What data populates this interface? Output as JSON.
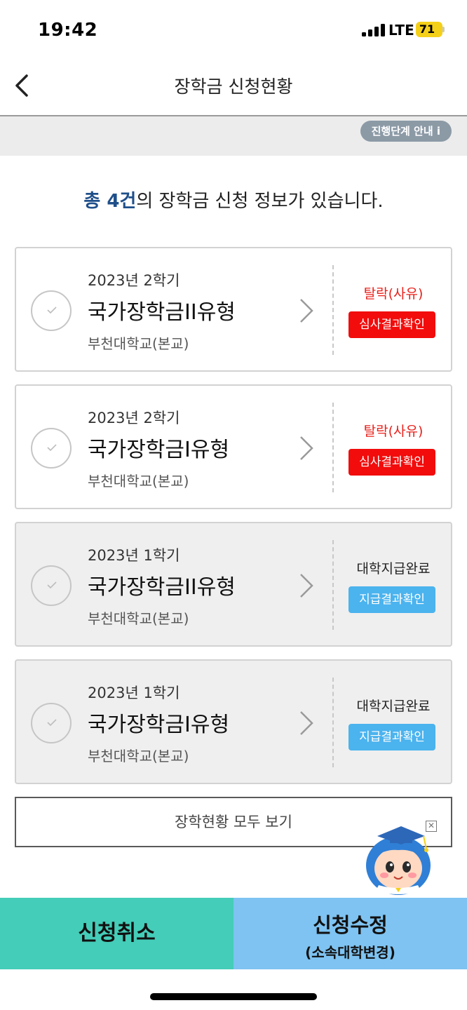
{
  "status_bar": {
    "time": "19:42",
    "network": "LTE",
    "battery": "71"
  },
  "header": {
    "title": "장학금 신청현황",
    "back_icon": "chevron-left-icon"
  },
  "stage_guide": {
    "label": "진행단계 안내 i"
  },
  "summary": {
    "highlight": "총 4건",
    "text": "의 장학금 신청 정보가 있습니다."
  },
  "cards": [
    {
      "semester": "2023년 2학기",
      "type": "국가장학금II유형",
      "school": "부천대학교(본교)",
      "status": "탈락(사유)",
      "action": "심사결과확인",
      "state": "rejected"
    },
    {
      "semester": "2023년 2학기",
      "type": "국가장학금I유형",
      "school": "부천대학교(본교)",
      "status": "탈락(사유)",
      "action": "심사결과확인",
      "state": "rejected"
    },
    {
      "semester": "2023년 1학기",
      "type": "국가장학금II유형",
      "school": "부천대학교(본교)",
      "status": "대학지급완료",
      "action": "지급결과확인",
      "state": "paid"
    },
    {
      "semester": "2023년 1학기",
      "type": "국가장학금I유형",
      "school": "부천대학교(본교)",
      "status": "대학지급완료",
      "action": "지급결과확인",
      "state": "paid"
    }
  ],
  "view_all": {
    "label": "장학현황 모두 보기"
  },
  "floating": {
    "close_icon": "close-square-icon",
    "mascot": "mascot-character"
  },
  "bottom": {
    "cancel_label": "신청취소",
    "edit_label": "신청수정",
    "edit_sub_label": "(소속대학변경)"
  },
  "colors": {
    "accent_blue": "#1f4f8a",
    "reject_red": "#f20c0c",
    "paid_blue": "#4bb3ee",
    "cancel_teal": "#44cdb8",
    "edit_blue": "#7ec3f1"
  }
}
